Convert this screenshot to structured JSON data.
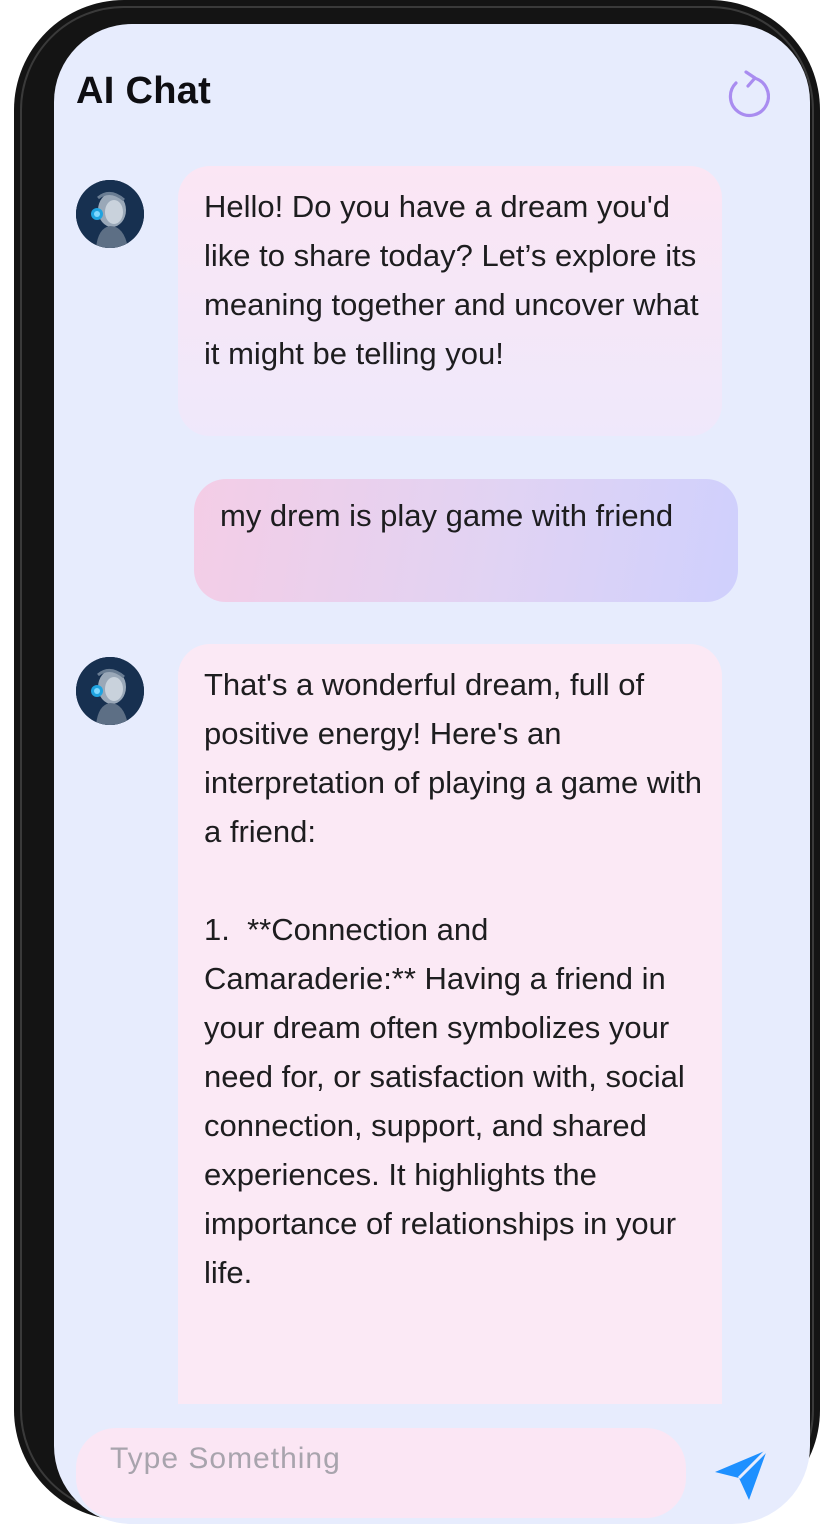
{
  "header": {
    "title": "AI Chat",
    "refresh_icon": "refresh-icon"
  },
  "messages": [
    {
      "sender": "bot",
      "text": "Hello! Do you have a dream you'd like to share today? Let’s explore its meaning together and uncover what it might be telling you!"
    },
    {
      "sender": "user",
      "text": "my drem is play game with friend"
    },
    {
      "sender": "bot",
      "text": "That's a wonderful dream, full of positive energy! Here's an interpretation of playing a game with a friend:\n\n1.  **Connection and Camaraderie:** Having a friend in your dream often symbolizes your need for, or satisfaction with, social connection, support, and shared experiences. It highlights the importance of relationships in your life."
    }
  ],
  "composer": {
    "placeholder": "Type Something",
    "value": "",
    "send_icon": "send-icon"
  },
  "colors": {
    "screen_bg": "#e7ecfd",
    "bot_bubble": "#fbe6f4",
    "user_bubble_start": "#f4cde6",
    "user_bubble_end": "#cfd0fd",
    "accent": "#a98cf0",
    "send": "#1e90ff"
  }
}
